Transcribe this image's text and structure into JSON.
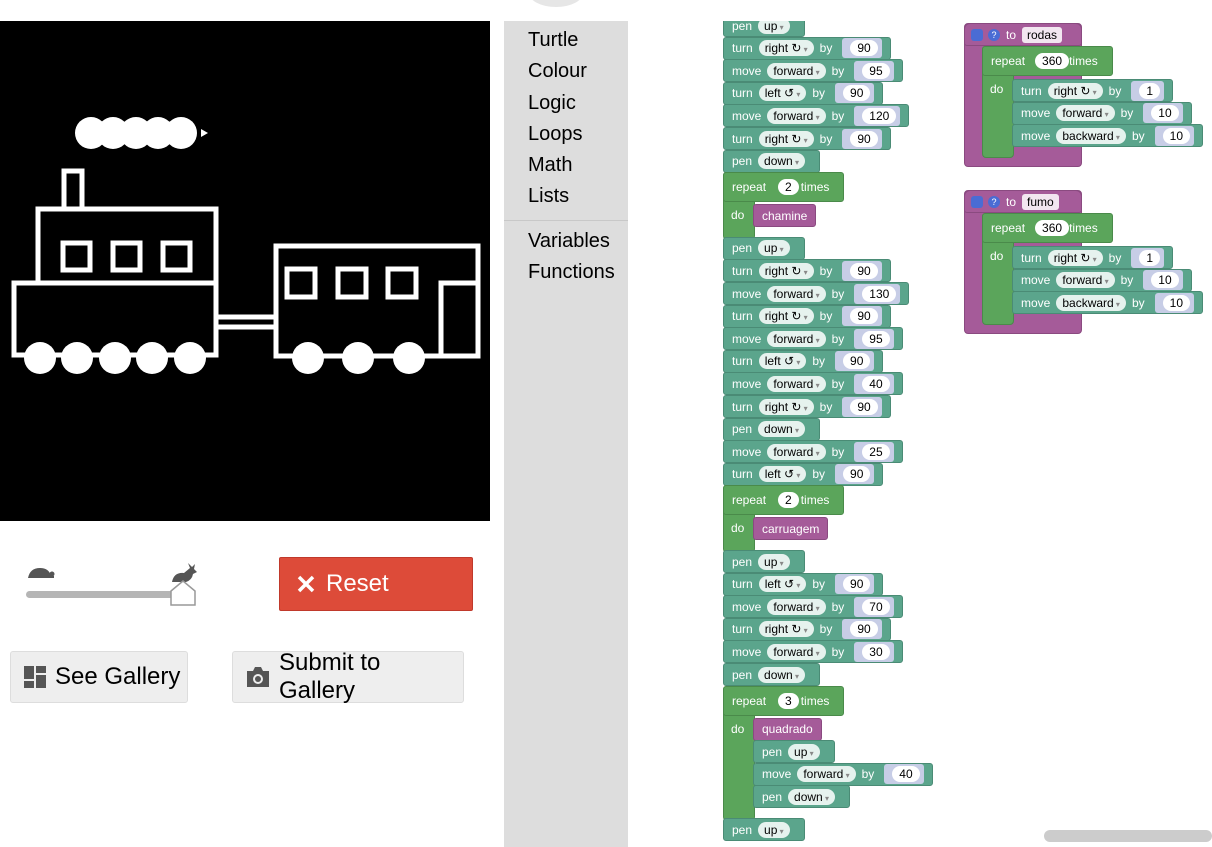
{
  "controls": {
    "reset_label": "Reset",
    "see_gallery_label": "See Gallery",
    "submit_gallery_label": "Submit to Gallery",
    "speed_level": 1.0
  },
  "toolbox": {
    "categories": [
      "Turtle",
      "Colour",
      "Logic",
      "Loops",
      "Math",
      "Lists",
      "Variables",
      "Functions"
    ]
  },
  "workspace": {
    "main_blocks": [
      {
        "kind": "pen",
        "state": "up"
      },
      {
        "kind": "turn",
        "dir": "right ↻",
        "value": "90"
      },
      {
        "kind": "move",
        "dir": "forward",
        "value": "95"
      },
      {
        "kind": "turn",
        "dir": "left ↺",
        "value": "90"
      },
      {
        "kind": "move",
        "dir": "forward",
        "value": "120"
      },
      {
        "kind": "turn",
        "dir": "right ↻",
        "value": "90"
      },
      {
        "kind": "pen",
        "state": "down"
      },
      {
        "kind": "repeat",
        "times": "2",
        "call": "chamine"
      },
      {
        "kind": "pen",
        "state": "up"
      },
      {
        "kind": "turn",
        "dir": "right ↻",
        "value": "90"
      },
      {
        "kind": "move",
        "dir": "forward",
        "value": "130"
      },
      {
        "kind": "turn",
        "dir": "right ↻",
        "value": "90"
      },
      {
        "kind": "move",
        "dir": "forward",
        "value": "95"
      },
      {
        "kind": "turn",
        "dir": "left ↺",
        "value": "90"
      },
      {
        "kind": "move",
        "dir": "forward",
        "value": "40"
      },
      {
        "kind": "turn",
        "dir": "right ↻",
        "value": "90"
      },
      {
        "kind": "pen",
        "state": "down"
      },
      {
        "kind": "move",
        "dir": "forward",
        "value": "25"
      },
      {
        "kind": "turn",
        "dir": "left ↺",
        "value": "90"
      },
      {
        "kind": "repeat",
        "times": "2",
        "call": "carruagem"
      },
      {
        "kind": "pen",
        "state": "up"
      },
      {
        "kind": "turn",
        "dir": "left ↺",
        "value": "90"
      },
      {
        "kind": "move",
        "dir": "forward",
        "value": "70"
      },
      {
        "kind": "turn",
        "dir": "right ↻",
        "value": "90"
      },
      {
        "kind": "move",
        "dir": "forward",
        "value": "30"
      },
      {
        "kind": "pen",
        "state": "down"
      },
      {
        "kind": "repeat",
        "times": "3",
        "call": "quadrado",
        "extra": [
          {
            "kind": "pen",
            "state": "up"
          },
          {
            "kind": "move",
            "dir": "forward",
            "value": "40"
          },
          {
            "kind": "pen",
            "state": "down"
          }
        ]
      },
      {
        "kind": "pen",
        "state": "up"
      }
    ],
    "procedures": [
      {
        "name": "rodas",
        "times": "360",
        "body": [
          {
            "kind": "turn",
            "dir": "right ↻",
            "value": "1"
          },
          {
            "kind": "move",
            "dir": "forward",
            "value": "10"
          },
          {
            "kind": "move",
            "dir": "backward",
            "value": "10"
          }
        ]
      },
      {
        "name": "fumo",
        "times": "360",
        "body": [
          {
            "kind": "turn",
            "dir": "right ↻",
            "value": "1"
          },
          {
            "kind": "move",
            "dir": "forward",
            "value": "10"
          },
          {
            "kind": "move",
            "dir": "backward",
            "value": "10"
          }
        ]
      }
    ],
    "labels": {
      "pen": "pen",
      "turn": "turn",
      "move": "move",
      "by": "by",
      "repeat": "repeat",
      "times": "times",
      "do": "do",
      "to": "to"
    }
  },
  "colors": {
    "reset": "#dd4b39",
    "turtle_block": "#5ba58c",
    "loop_block": "#5ba55b",
    "proc_block": "#a55b99",
    "toolbox": "#dddddd"
  },
  "icons": {
    "reset": "close-icon",
    "see_gallery": "dashboard-icon",
    "submit_gallery": "camera-icon",
    "slow": "tortoise-icon",
    "fast": "hare-icon"
  }
}
